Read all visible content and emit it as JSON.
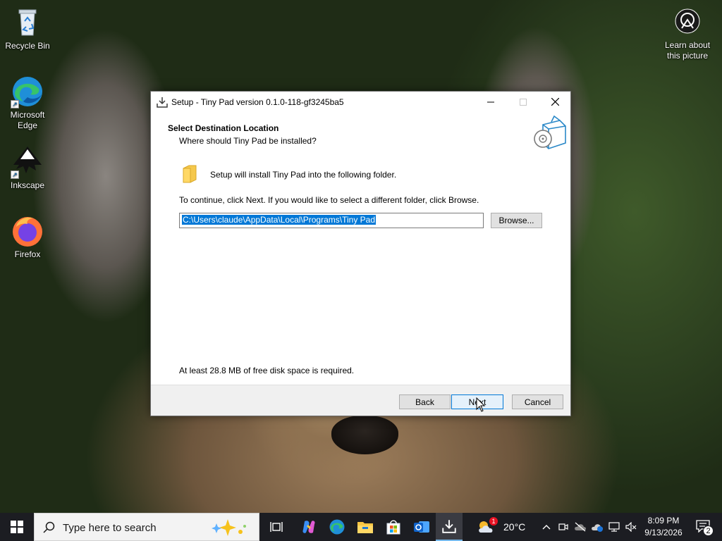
{
  "desktop": {
    "icons": [
      {
        "label": "Recycle Bin"
      },
      {
        "label": "Microsoft Edge"
      },
      {
        "label": "Inkscape"
      },
      {
        "label": "Firefox"
      }
    ],
    "learn_about": "Learn about this picture"
  },
  "installer": {
    "window_title": "Setup - Tiny Pad version 0.1.0-118-gf3245ba5",
    "heading": "Select Destination Location",
    "subheading": "Where should Tiny Pad be installed?",
    "folder_message": "Setup will install Tiny Pad into the following folder.",
    "instruction": "To continue, click Next. If you would like to select a different folder, click Browse.",
    "path_value": "C:\\Users\\claude\\AppData\\Local\\Programs\\Tiny Pad",
    "browse_label": "Browse...",
    "disk_space": "At least 28.8 MB of free disk space is required.",
    "back_label": "Back",
    "next_label": "Next",
    "cancel_label": "Cancel"
  },
  "taskbar": {
    "search_placeholder": "Type here to search",
    "weather_temp": "20°C",
    "weather_badge": "1",
    "time": "8:09 PM",
    "date": "9/13/2026",
    "notification_count": "2",
    "pinned": [
      "task-view",
      "copilot",
      "edge",
      "file-explorer",
      "microsoft-store",
      "outlook",
      "setup"
    ]
  },
  "colors": {
    "accent": "#0078d7",
    "taskbar_bg": "#1c1d22",
    "dialog_footer": "#f0f0f0"
  }
}
